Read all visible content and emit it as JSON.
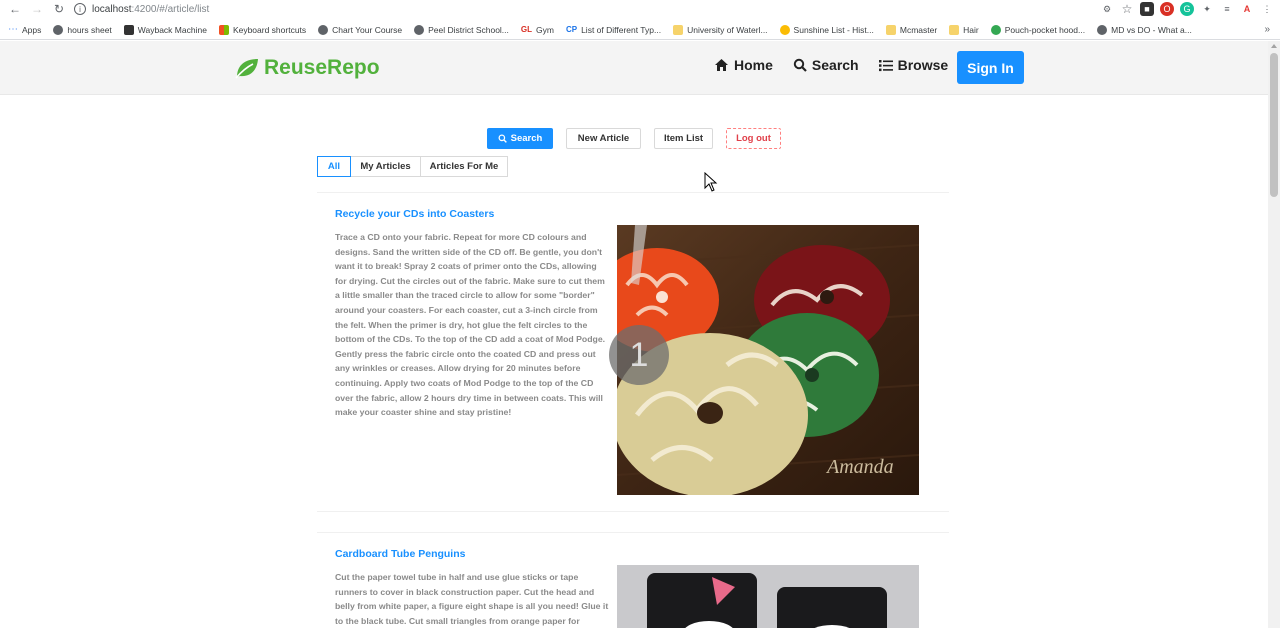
{
  "browser": {
    "url_host": "localhost",
    "url_path": ":4200/#/article/list",
    "bookmarks": [
      {
        "label": "Apps",
        "color": "#4285f4"
      },
      {
        "label": "hours sheet",
        "color": "#5f6368"
      },
      {
        "label": "Wayback Machine",
        "color": "#333333"
      },
      {
        "label": "Keyboard shortcuts",
        "color": "#f25022"
      },
      {
        "label": "Chart Your Course",
        "color": "#5f6368"
      },
      {
        "label": "Peel District School...",
        "color": "#5f6368"
      },
      {
        "label": "Gym",
        "color": "#d93025"
      },
      {
        "label": "List of Different Typ...",
        "color": "#1a73e8"
      },
      {
        "label": "University of Waterl...",
        "color": "#f6d36b"
      },
      {
        "label": "Sunshine List - Hist...",
        "color": "#fbbc04"
      },
      {
        "label": "Mcmaster",
        "color": "#f6d36b"
      },
      {
        "label": "Hair",
        "color": "#f6d36b"
      },
      {
        "label": "Pouch-pocket hood...",
        "color": "#34a853"
      },
      {
        "label": "MD vs DO - What a...",
        "color": "#5f6368"
      }
    ]
  },
  "header": {
    "brand": "ReuseRepo",
    "brand_color": "#52b13c",
    "nav": [
      {
        "label": "Home",
        "icon": "home-icon"
      },
      {
        "label": "Search",
        "icon": "search-icon"
      },
      {
        "label": "Browse",
        "icon": "list-icon"
      }
    ],
    "signin_label": "Sign In"
  },
  "actions": {
    "search_label": "Search",
    "new_article_label": "New Article",
    "item_list_label": "Item List",
    "logout_label": "Log out"
  },
  "tabs": {
    "all": "All",
    "my_articles": "My Articles",
    "articles_for_me": "Articles For Me",
    "active": "All"
  },
  "articles": [
    {
      "title": "Recycle your CDs into Coasters",
      "body": "Trace a CD onto your fabric. Repeat for more CD colours and designs. Sand the written side of the CD off. Be gentle, you don't want it to break! Spray 2 coats of primer onto the CDs, allowing for drying. Cut the circles out of the fabric. Make sure to cut them a little smaller than the traced circle to allow for some \"border\" around your coasters. For each coaster, cut a 3-inch circle from the felt. When the primer is dry, hot glue the felt circles to the bottom of the CDs. To the top of the CD add a coat of Mod Podge. Gently press the fabric circle onto the coated CD and press out any wrinkles or creases. Allow drying for 20 minutes before continuing. Apply two coats of Mod Podge to the top of the CD over the fabric, allow 2 hours dry time in between coats. This will make your coaster shine and stay pristine!",
      "watermark": "Amanda"
    },
    {
      "title": "Cardboard Tube Penguins",
      "body": "Cut the paper towel tube in half and use glue sticks or tape runners to cover in black construction paper. Cut the head and belly from white paper, a figure eight shape is all you need! Glue it to the black tube. Cut small triangles from orange paper for"
    }
  ],
  "overlay": {
    "slide_number": "1"
  }
}
